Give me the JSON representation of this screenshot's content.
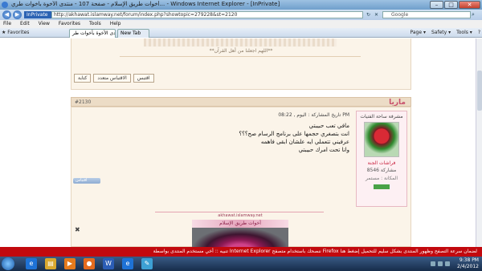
{
  "window": {
    "title": "أخوات طريق الإسلام - صفحة 107 - منتدى الأخوة بأخوات طري... - Windows Internet Explorer - [InPrivate]",
    "min": "–",
    "max": "□",
    "close": "✕"
  },
  "address": {
    "back": "◀",
    "forward": "▶",
    "inprivate": "InPrivate",
    "url": "http://akhawat.islamway.net/forum/index.php?showtopic=279228&st=2120",
    "refresh": "↻",
    "stop": "✕",
    "search_placeholder": "Google",
    "search_icon": "⌕"
  },
  "menu": [
    "File",
    "Edit",
    "View",
    "Favorites",
    "Tools",
    "Help"
  ],
  "favorites": {
    "label": "Favorites",
    "tabs": [
      {
        "label": "منتدى الأخوة بأخوات طر..."
      },
      {
        "label": "New Tab"
      }
    ],
    "commands": [
      "Page ▾",
      "Safety ▾",
      "Tools ▾",
      "?"
    ]
  },
  "prev_post": {
    "signature": "**اللهم اجعلنا من أهل القرآن**",
    "buttons": [
      "كتابة",
      "الاقتباس متعدد",
      "اقتبس"
    ]
  },
  "post": {
    "number": "#2130",
    "author": "ماريا",
    "date": "تاريخ المشاركة : اليوم , 08:22 PM",
    "lines": [
      "مافي تعب حبيبتي",
      "انت بتصغري حجمها على برنامج الرسام صح؟؟؟",
      "عرفيني تتعملي ايه علشان ابقى فاهمه",
      "وانا تحت امرك حبيبتي"
    ],
    "quote_button": "اقتباس"
  },
  "author_card": {
    "label": "مشرفة ساحة الفتيات",
    "name": "فراشات الجنة",
    "posts": "8546 مشاركة",
    "rank": "المكانة : مستمر"
  },
  "signature": {
    "site": "akhawat.islamway.net",
    "banner": "أخوات طريق الإسلام"
  },
  "notice": {
    "text": "تنبيه :: أخي مستخدم المنتدى بواسطة Internet Explorer ننصحك باستخدام متصفح Firefox لضمان سرعة التصفح وظهور المنتدى بشكل سليم للتحميل إضغط هنا"
  },
  "taskbar": {
    "time": "9:38 PM",
    "date": "2/4/2012",
    "icons": [
      {
        "name": "ie-icon",
        "glyph": "e",
        "color": "#1e72d6"
      },
      {
        "name": "folder-icon",
        "glyph": "▤",
        "color": "#d9a82e"
      },
      {
        "name": "media-player-icon",
        "glyph": "▶",
        "color": "#e57a1c"
      },
      {
        "name": "firefox-icon",
        "glyph": "●",
        "color": "#e46b1e"
      },
      {
        "name": "word-icon",
        "glyph": "W",
        "color": "#2b5db6"
      },
      {
        "name": "ie-window-icon",
        "glyph": "e",
        "color": "#1e72d6"
      },
      {
        "name": "paint-icon",
        "glyph": "✎",
        "color": "#3da0d4"
      }
    ]
  }
}
